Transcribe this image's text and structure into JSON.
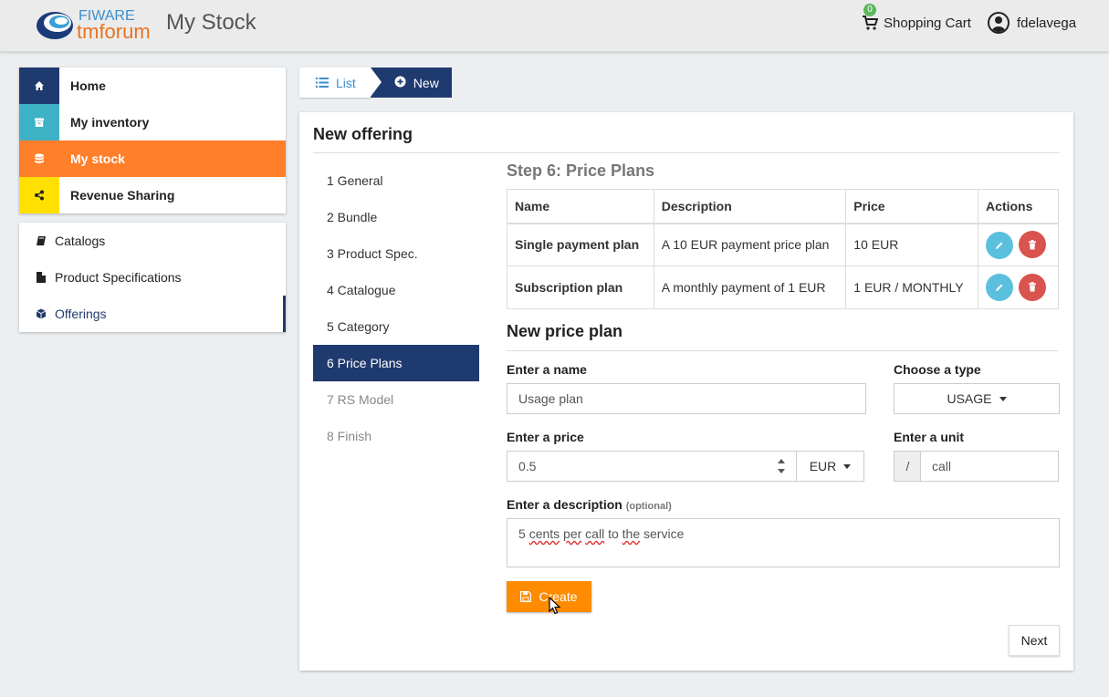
{
  "header": {
    "logo_top": "FIWARE",
    "logo_bottom": "tmforum",
    "app_title": "My Stock",
    "cart_label": "Shopping Cart",
    "cart_count": "0",
    "username": "fdelavega"
  },
  "nav_main": [
    {
      "label": "Home",
      "icon": "home-icon",
      "color": "#1f3a6e"
    },
    {
      "label": "My inventory",
      "icon": "archive-icon",
      "color": "#3db2c4"
    },
    {
      "label": "My stock",
      "icon": "database-icon",
      "color": "#ff7f2a"
    },
    {
      "label": "Revenue Sharing",
      "icon": "share-icon",
      "color": "#ffe000"
    }
  ],
  "nav_sub": [
    {
      "label": "Catalogs",
      "icon": "book-icon"
    },
    {
      "label": "Product Specifications",
      "icon": "file-icon"
    },
    {
      "label": "Offerings",
      "icon": "cube-icon"
    }
  ],
  "breadcrumb": {
    "list_label": "List",
    "new_label": "New"
  },
  "panel": {
    "title": "New offering",
    "steps": [
      "1 General",
      "2 Bundle",
      "3 Product Spec.",
      "4 Catalogue",
      "5 Category",
      "6 Price Plans",
      "7 RS Model",
      "8 Finish"
    ],
    "active_step": 5,
    "step_title": "Step 6: Price Plans"
  },
  "plans_table": {
    "headers": [
      "Name",
      "Description",
      "Price",
      "Actions"
    ],
    "rows": [
      {
        "name": "Single payment plan",
        "description": "A 10 EUR payment price plan",
        "price": "10 EUR"
      },
      {
        "name": "Subscription plan",
        "description": "A monthly payment of 1 EUR",
        "price": "1 EUR / MONTHLY"
      }
    ]
  },
  "form": {
    "section_title": "New price plan",
    "name_label": "Enter a name",
    "name_value": "Usage plan",
    "type_label": "Choose a type",
    "type_value": "USAGE",
    "price_label": "Enter a price",
    "price_value": "0.5",
    "currency_value": "EUR",
    "unit_label": "Enter a unit",
    "unit_prefix": "/",
    "unit_value": "call",
    "description_label": "Enter a description",
    "description_optional": "(optional)",
    "description_words": [
      "5",
      "cents",
      "per",
      "call",
      "to",
      "the",
      "service"
    ],
    "create_label": "Create",
    "next_label": "Next"
  },
  "colors": {
    "primary": "#1f3a6e",
    "accent": "#ff7f2a",
    "create": "#ff8c00",
    "edit": "#5bc0de",
    "delete": "#d9534f"
  }
}
